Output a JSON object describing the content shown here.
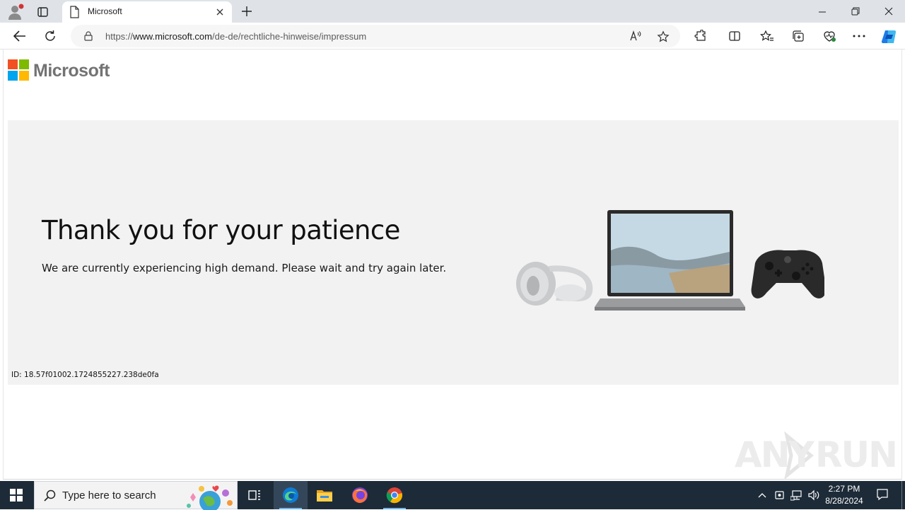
{
  "browser": {
    "tab": {
      "title": "Microsoft"
    },
    "address": {
      "url_prefix": "https://",
      "url_domain": "www.microsoft.com",
      "url_path": "/de-de/rechtliche-hinweise/impressum"
    }
  },
  "page": {
    "logo_text": "Microsoft",
    "title": "Thank you for your patience",
    "subtitle": "We are currently experiencing high demand. Please wait and try again later.",
    "reference_id": "ID: 18.57f01002.1724855227.238de0fa"
  },
  "watermark": {
    "left": "ANY",
    "right": "RUN"
  },
  "taskbar": {
    "search_placeholder": "Type here to search",
    "time": "2:27 PM",
    "date": "8/28/2024",
    "apps": [
      "edge-icon",
      "file-explorer-icon",
      "firefox-icon",
      "chrome-icon"
    ]
  },
  "colors": {
    "ms_red": "#f25022",
    "ms_green": "#7fba00",
    "ms_blue": "#00a4ef",
    "ms_yellow": "#ffb900",
    "hero_bg": "#f2f2f2",
    "taskbar_bg": "#1d2b38"
  }
}
